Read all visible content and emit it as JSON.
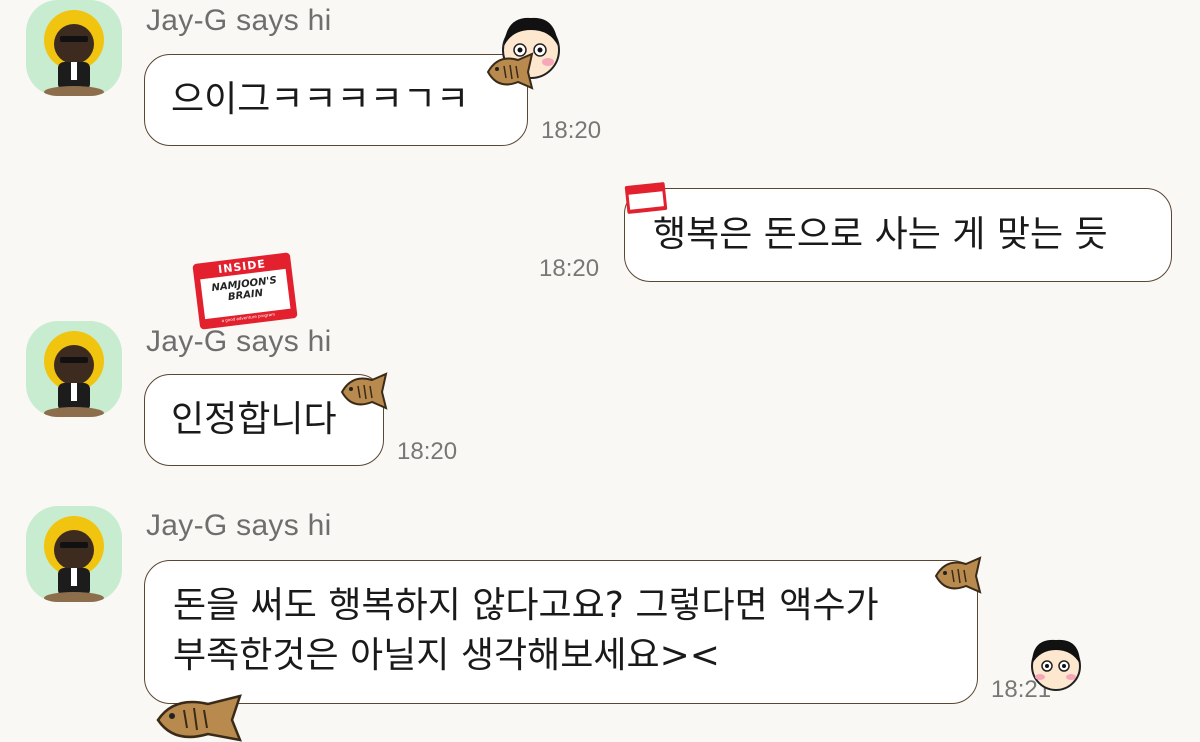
{
  "messages": [
    {
      "sender": "Jay-G says hi",
      "text": "으이그ㅋㅋㅋㅋㄱㅋ",
      "time": "18:20"
    },
    {
      "text": "행복은 돈으로 사는 게 맞는 듯",
      "time": "18:20"
    },
    {
      "sender": "Jay-G says hi",
      "text": "인정합니다",
      "time": "18:20"
    },
    {
      "sender": "Jay-G says hi",
      "lines": [
        "돈을 써도 행복하지 않다고요? 그렇다면 액수가",
        "부족한것은 아닐지 생각해보세요><"
      ],
      "time": "18:21"
    }
  ],
  "sticker": {
    "line1": "INSIDE",
    "line2": "NAMJOON'S",
    "line3": "BRAIN",
    "line4": "a good adventure program"
  },
  "colors": {
    "background": "#f9f8f4",
    "avatar_bg": "#c8ecd0",
    "bubble_border": "#5a4632",
    "sticker_red": "#e3202d"
  },
  "icons": [
    "avatar-character-icon",
    "fish-bread-icon",
    "cartoon-face-icon",
    "inside-brain-sticker-icon"
  ]
}
